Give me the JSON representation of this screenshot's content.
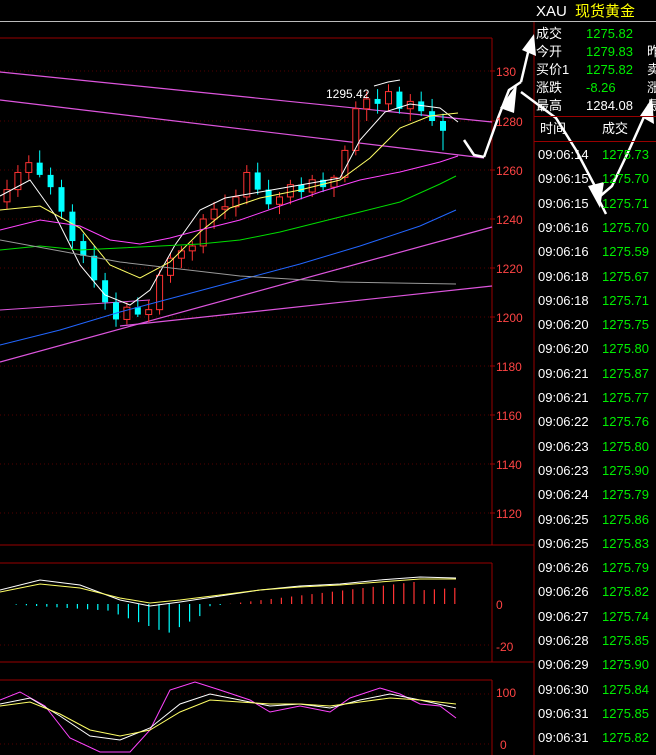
{
  "quote_panel": {
    "symbol": "XAU",
    "name": "现货黄金",
    "fields": [
      {
        "label": "成交",
        "value": "1275.82",
        "extra": ""
      },
      {
        "label": "今开",
        "value": "1279.83",
        "extra": "昨"
      },
      {
        "label": "买价1",
        "value": "1275.82",
        "extra": "卖"
      },
      {
        "label": "涨跌",
        "value": "-8.26",
        "extra": "涨"
      },
      {
        "label": "最高",
        "value": "1284.08",
        "extra": "最"
      }
    ],
    "ticks_header": {
      "time": "时间",
      "price": "成交"
    },
    "ticks": [
      {
        "time": "09:06:14",
        "price": "1275.73"
      },
      {
        "time": "09:06:15",
        "price": "1275.70"
      },
      {
        "time": "09:06:15",
        "price": "1275.71"
      },
      {
        "time": "09:06:16",
        "price": "1275.70"
      },
      {
        "time": "09:06:16",
        "price": "1275.59"
      },
      {
        "time": "09:06:18",
        "price": "1275.67"
      },
      {
        "time": "09:06:18",
        "price": "1275.71"
      },
      {
        "time": "09:06:20",
        "price": "1275.75"
      },
      {
        "time": "09:06:20",
        "price": "1275.80"
      },
      {
        "time": "09:06:21",
        "price": "1275.87"
      },
      {
        "time": "09:06:21",
        "price": "1275.77"
      },
      {
        "time": "09:06:22",
        "price": "1275.76"
      },
      {
        "time": "09:06:23",
        "price": "1275.80"
      },
      {
        "time": "09:06:23",
        "price": "1275.90"
      },
      {
        "time": "09:06:24",
        "price": "1275.79"
      },
      {
        "time": "09:06:25",
        "price": "1275.86"
      },
      {
        "time": "09:06:25",
        "price": "1275.83"
      },
      {
        "time": "09:06:26",
        "price": "1275.79"
      },
      {
        "time": "09:06:26",
        "price": "1275.82"
      },
      {
        "time": "09:06:27",
        "price": "1275.74"
      },
      {
        "time": "09:06:28",
        "price": "1275.85"
      },
      {
        "time": "09:06:29",
        "price": "1275.90"
      },
      {
        "time": "09:06:30",
        "price": "1275.84"
      },
      {
        "time": "09:06:31",
        "price": "1275.85"
      },
      {
        "time": "09:06:31",
        "price": "1275.82"
      }
    ]
  },
  "main_chart": {
    "high_label": "1295.42",
    "y_ticks": [
      "130",
      "1280",
      "1260",
      "1240",
      "1220",
      "1200",
      "1180",
      "1160",
      "1140",
      "1120"
    ]
  },
  "macd_panel": {
    "y_ticks": [
      "0",
      "-20"
    ]
  },
  "kdj_panel": {
    "y_ticks": [
      "100",
      "0"
    ]
  },
  "colors": {
    "up": "#ff3333",
    "down": "#00ffff",
    "price_up": "#00ee00",
    "price_down": "#ff4444",
    "grid": "#990000",
    "ma5": "#ffffff",
    "ma10": "#ffff66",
    "ma20": "#ff44ff",
    "ma30": "#00dd00",
    "ma60": "#2266ff",
    "trend": "#dd55dd",
    "symbol_name": "#ffff00"
  }
}
